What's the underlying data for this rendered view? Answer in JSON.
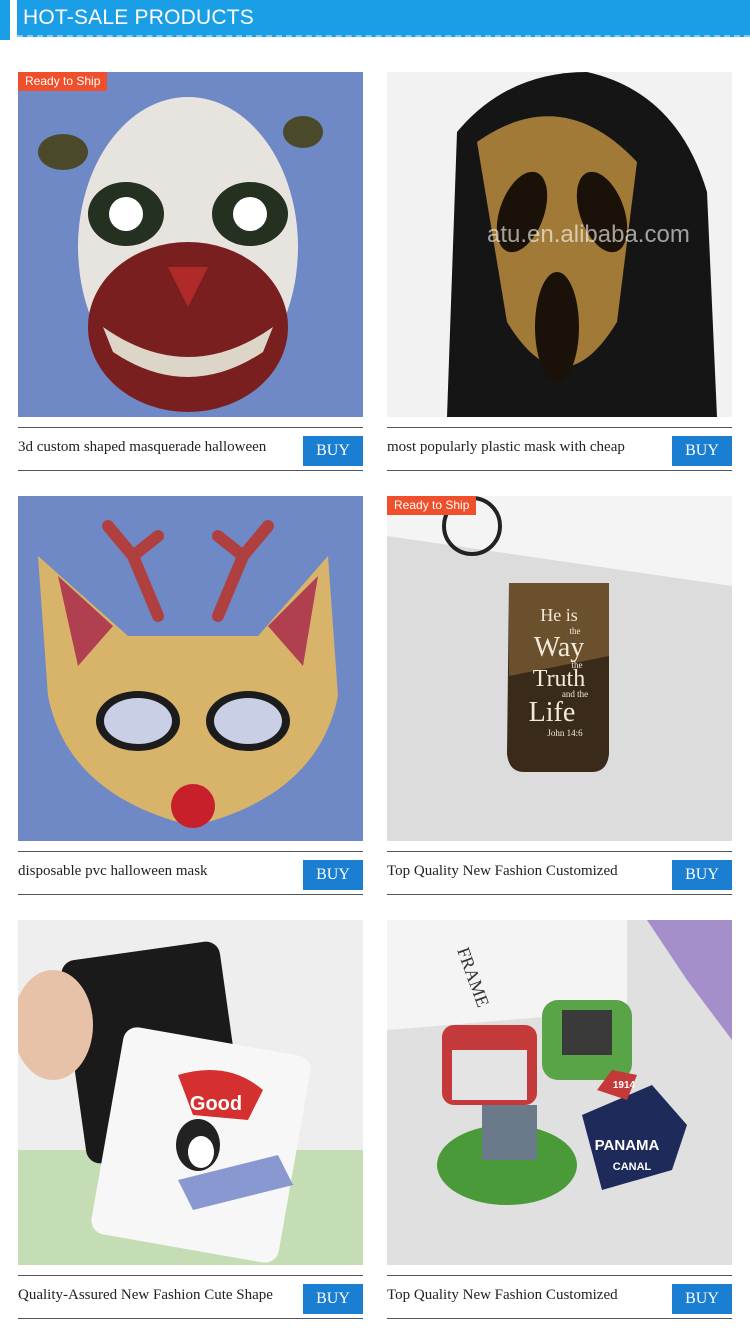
{
  "header": {
    "title": "HOT-SALE PRODUCTS"
  },
  "badges": {
    "ready": "Ready to Ship"
  },
  "watermark": "atu.en.alibaba.com",
  "products": [
    {
      "name": "3d custom shaped masquerade halloween",
      "buy": "BUY",
      "badge": "Ready to Ship"
    },
    {
      "name": "most popularly plastic mask with cheap",
      "buy": "BUY"
    },
    {
      "name": "disposable pvc halloween mask",
      "buy": "BUY"
    },
    {
      "name": "Top Quality New Fashion Customized",
      "buy": "BUY",
      "badge": "Ready to Ship"
    },
    {
      "name": "Quality-Assured New Fashion Cute Shape",
      "buy": "BUY"
    },
    {
      "name": "Top Quality New Fashion Customized",
      "buy": "BUY"
    }
  ],
  "image_text": {
    "bookmark_lines": [
      "He is",
      "the",
      "Way",
      "the",
      "Truth",
      "and the",
      "Life",
      "John 14:6"
    ],
    "good": "Good",
    "panama": "PANAMA",
    "canal": "CANAL",
    "frame": "FRAME",
    "year": "1914"
  },
  "colors": {
    "accent": "#1a9ee6",
    "buy_button": "#1a7fd1",
    "badge": "#ef4f2a"
  }
}
